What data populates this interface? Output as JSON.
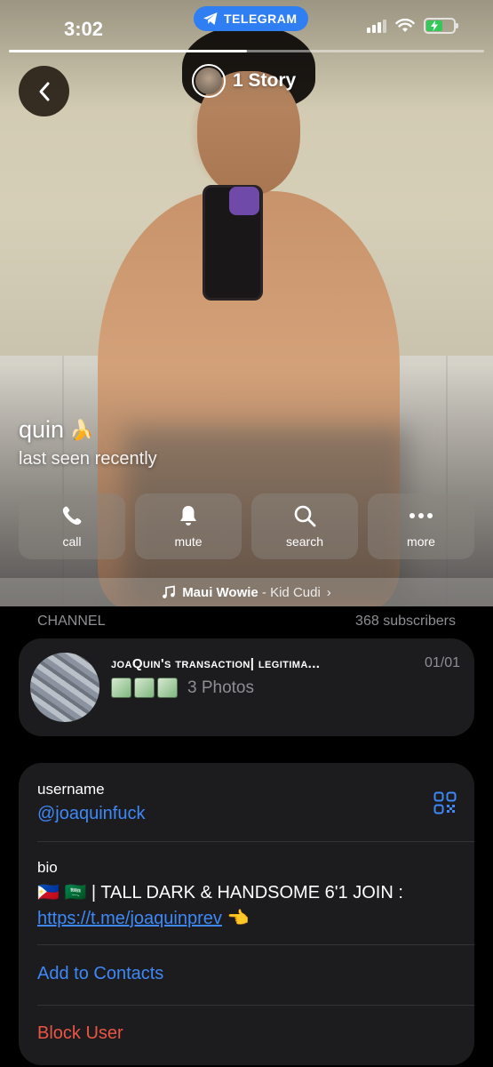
{
  "status_bar": {
    "time": "3:02",
    "app_pill": "TELEGRAM",
    "battery_charging": true
  },
  "story": {
    "label": "1 Story",
    "progress": 0.5
  },
  "profile": {
    "name": "quin",
    "name_emoji": "🍌",
    "status": "last seen recently"
  },
  "actions": [
    {
      "label": "call",
      "icon": "phone-icon"
    },
    {
      "label": "mute",
      "icon": "bell-icon"
    },
    {
      "label": "search",
      "icon": "search-icon"
    },
    {
      "label": "more",
      "icon": "more-icon"
    }
  ],
  "music": {
    "title": "Maui Wowie",
    "separator": " - ",
    "artist": "Kid Cudi",
    "chevron": "›"
  },
  "channel": {
    "section_label": "CHANNEL",
    "subscribers": "368 subscribers",
    "title": "joaQuin's transaction| legitima...",
    "counter": "01/01",
    "photos_label": "3 Photos"
  },
  "info": {
    "username_label": "username",
    "username": "@joaquinfuck",
    "bio_label": "bio",
    "bio_flags": "🇵🇭 🇸🇦",
    "bio_text": " | TALL DARK & HANDSOME 6'1 JOIN :",
    "bio_link": "https://t.me/joaquinprev",
    "bio_emoji": "👈",
    "add_contacts": "Add to Contacts",
    "block_user": "Block User"
  },
  "colors": {
    "accent": "#3e88f7",
    "danger": "#eb5545",
    "card": "#1c1c1e",
    "telegram_blue": "#2f7ff3"
  }
}
